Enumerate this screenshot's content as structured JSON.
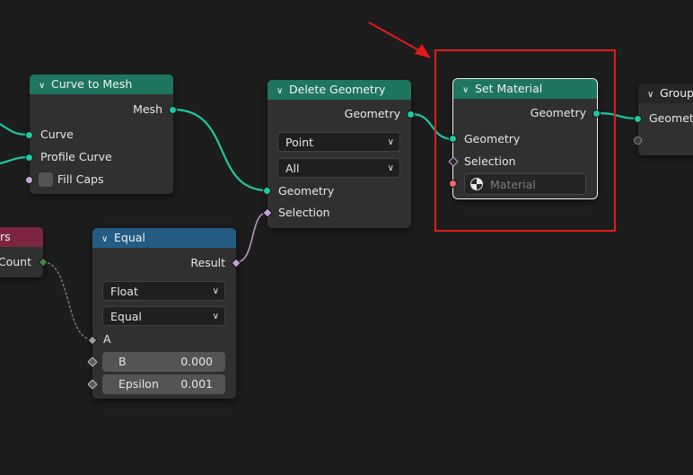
{
  "nodes": {
    "curve_to_mesh": {
      "title": "Curve to Mesh",
      "outputs": [
        "Mesh"
      ],
      "inputs": [
        "Curve",
        "Profile Curve",
        "Fill Caps"
      ]
    },
    "delete_geometry": {
      "title": "Delete Geometry",
      "output": "Geometry",
      "domain_select": "Point",
      "mode_select": "All",
      "inputs": [
        "Geometry",
        "Selection"
      ]
    },
    "set_material": {
      "title": "Set Material",
      "output": "Geometry",
      "inputs": [
        "Geometry",
        "Selection"
      ],
      "material_placeholder": "Material"
    },
    "group_output": {
      "title": "Group",
      "inputs": [
        "Geometry"
      ]
    },
    "input_node": {
      "title": "rs",
      "output": "Count"
    },
    "equal": {
      "title": "Equal",
      "output": "Result",
      "data_type": "Float",
      "operation": "Equal",
      "input_a": "A",
      "input_b_label": "B",
      "input_b_value": "0.000",
      "epsilon_label": "Epsilon",
      "epsilon_value": "0.001"
    }
  },
  "colors": {
    "geometry_socket": "#1ec8a0",
    "geometry_header": "#1e7560",
    "math_header": "#245c84",
    "input_header": "#7c2540",
    "highlight": "#e01b1b"
  }
}
